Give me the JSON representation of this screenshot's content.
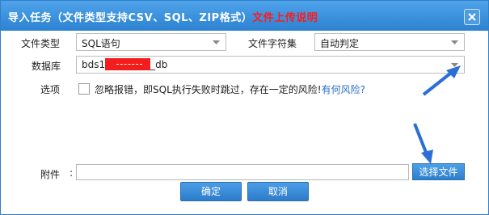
{
  "dialog": {
    "title": "导入任务（文件类型支持CSV、SQL、ZIP格式）",
    "title_link": "文件上传说明"
  },
  "form": {
    "file_type_label": "文件类型",
    "file_type_value": "SQL语句",
    "charset_label": "文件字符集",
    "charset_value": "自动判定",
    "database_label": "数据库",
    "database_prefix": "bds1",
    "database_suffix": "_db",
    "options_label": "选项",
    "ignore_errors_text": "忽略报错，即SQL执行失败时跳过，存在一定的风险!",
    "risk_link": "有何风险?",
    "attachment_label": "附件",
    "attachment_value": "",
    "browse_button": "选择文件"
  },
  "footer": {
    "confirm": "确定",
    "cancel": "取消"
  },
  "colors": {
    "title_bar": "#3a8fde",
    "title_link": "#ff1a1a",
    "button": "#3a8cd8",
    "annotation_arrow": "#2a6ed6",
    "redaction": "#f41c1c"
  }
}
